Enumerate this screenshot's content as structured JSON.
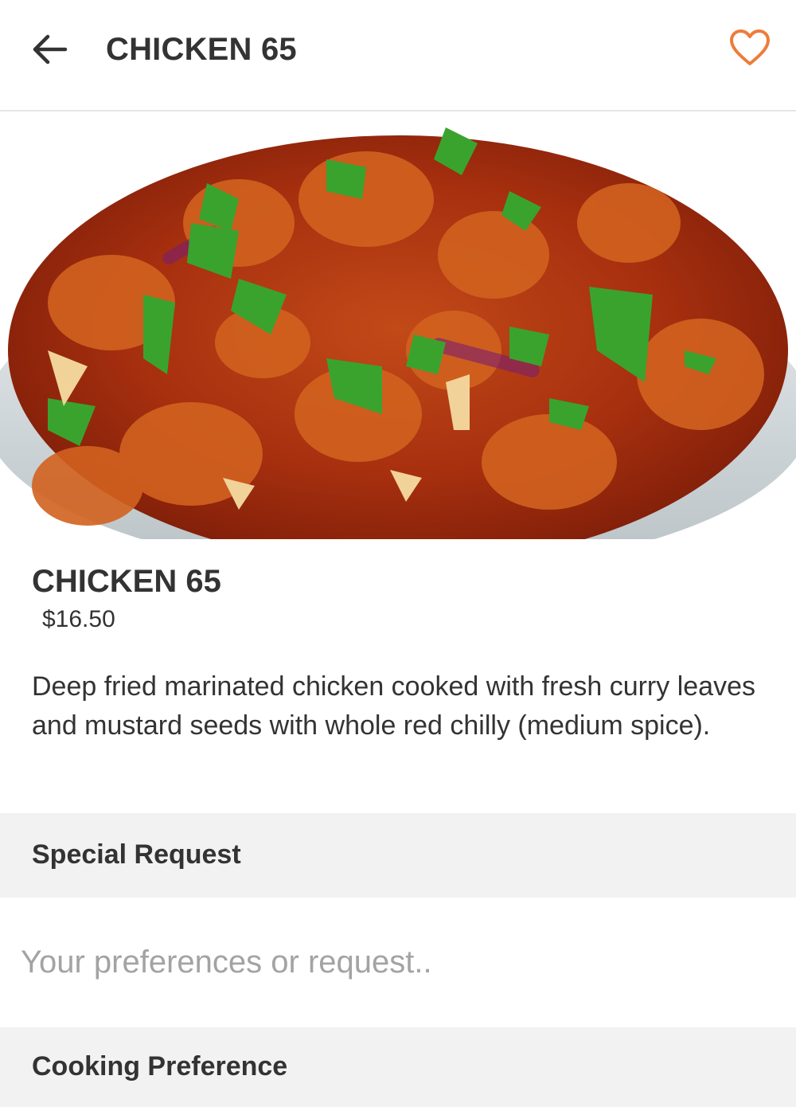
{
  "header": {
    "title": "CHICKEN 65",
    "back_icon": "arrow-left-icon",
    "favorite_icon": "heart-outline-icon"
  },
  "item": {
    "name": "CHICKEN 65",
    "price": "$16.50",
    "description": "Deep fried marinated chicken cooked with fresh curry leaves and mustard seeds with whole red chilly (medium spice).",
    "image_alt": "plate of chicken 65"
  },
  "special_request": {
    "label": "Special Request",
    "placeholder": "Your preferences or request.."
  },
  "cooking_preference": {
    "label": "Cooking Preference"
  },
  "colors": {
    "accent": "#ee7b3a",
    "text": "#333333",
    "section_bg": "#f2f2f2",
    "placeholder": "#a3a3a3"
  }
}
